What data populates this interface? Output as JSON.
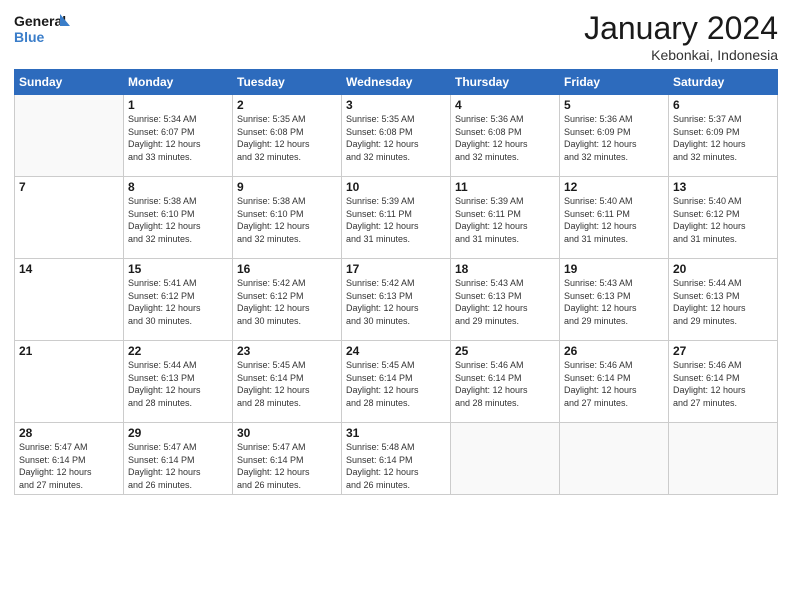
{
  "logo": {
    "line1": "General",
    "line2": "Blue"
  },
  "title": "January 2024",
  "location": "Kebonkai, Indonesia",
  "days_header": [
    "Sunday",
    "Monday",
    "Tuesday",
    "Wednesday",
    "Thursday",
    "Friday",
    "Saturday"
  ],
  "weeks": [
    [
      {
        "day": "",
        "info": ""
      },
      {
        "day": "1",
        "info": "Sunrise: 5:34 AM\nSunset: 6:07 PM\nDaylight: 12 hours\nand 33 minutes."
      },
      {
        "day": "2",
        "info": "Sunrise: 5:35 AM\nSunset: 6:08 PM\nDaylight: 12 hours\nand 32 minutes."
      },
      {
        "day": "3",
        "info": "Sunrise: 5:35 AM\nSunset: 6:08 PM\nDaylight: 12 hours\nand 32 minutes."
      },
      {
        "day": "4",
        "info": "Sunrise: 5:36 AM\nSunset: 6:08 PM\nDaylight: 12 hours\nand 32 minutes."
      },
      {
        "day": "5",
        "info": "Sunrise: 5:36 AM\nSunset: 6:09 PM\nDaylight: 12 hours\nand 32 minutes."
      },
      {
        "day": "6",
        "info": "Sunrise: 5:37 AM\nSunset: 6:09 PM\nDaylight: 12 hours\nand 32 minutes."
      }
    ],
    [
      {
        "day": "7",
        "info": ""
      },
      {
        "day": "8",
        "info": "Sunrise: 5:38 AM\nSunset: 6:10 PM\nDaylight: 12 hours\nand 32 minutes."
      },
      {
        "day": "9",
        "info": "Sunrise: 5:38 AM\nSunset: 6:10 PM\nDaylight: 12 hours\nand 32 minutes."
      },
      {
        "day": "10",
        "info": "Sunrise: 5:39 AM\nSunset: 6:11 PM\nDaylight: 12 hours\nand 31 minutes."
      },
      {
        "day": "11",
        "info": "Sunrise: 5:39 AM\nSunset: 6:11 PM\nDaylight: 12 hours\nand 31 minutes."
      },
      {
        "day": "12",
        "info": "Sunrise: 5:40 AM\nSunset: 6:11 PM\nDaylight: 12 hours\nand 31 minutes."
      },
      {
        "day": "13",
        "info": "Sunrise: 5:40 AM\nSunset: 6:12 PM\nDaylight: 12 hours\nand 31 minutes."
      }
    ],
    [
      {
        "day": "14",
        "info": ""
      },
      {
        "day": "15",
        "info": "Sunrise: 5:41 AM\nSunset: 6:12 PM\nDaylight: 12 hours\nand 30 minutes."
      },
      {
        "day": "16",
        "info": "Sunrise: 5:42 AM\nSunset: 6:12 PM\nDaylight: 12 hours\nand 30 minutes."
      },
      {
        "day": "17",
        "info": "Sunrise: 5:42 AM\nSunset: 6:13 PM\nDaylight: 12 hours\nand 30 minutes."
      },
      {
        "day": "18",
        "info": "Sunrise: 5:43 AM\nSunset: 6:13 PM\nDaylight: 12 hours\nand 29 minutes."
      },
      {
        "day": "19",
        "info": "Sunrise: 5:43 AM\nSunset: 6:13 PM\nDaylight: 12 hours\nand 29 minutes."
      },
      {
        "day": "20",
        "info": "Sunrise: 5:44 AM\nSunset: 6:13 PM\nDaylight: 12 hours\nand 29 minutes."
      }
    ],
    [
      {
        "day": "21",
        "info": ""
      },
      {
        "day": "22",
        "info": "Sunrise: 5:44 AM\nSunset: 6:13 PM\nDaylight: 12 hours\nand 28 minutes."
      },
      {
        "day": "23",
        "info": "Sunrise: 5:45 AM\nSunset: 6:14 PM\nDaylight: 12 hours\nand 28 minutes."
      },
      {
        "day": "24",
        "info": "Sunrise: 5:45 AM\nSunset: 6:14 PM\nDaylight: 12 hours\nand 28 minutes."
      },
      {
        "day": "25",
        "info": "Sunrise: 5:46 AM\nSunset: 6:14 PM\nDaylight: 12 hours\nand 28 minutes."
      },
      {
        "day": "26",
        "info": "Sunrise: 5:46 AM\nSunset: 6:14 PM\nDaylight: 12 hours\nand 27 minutes."
      },
      {
        "day": "27",
        "info": "Sunrise: 5:46 AM\nSunset: 6:14 PM\nDaylight: 12 hours\nand 27 minutes."
      }
    ],
    [
      {
        "day": "28",
        "info": "Sunrise: 5:47 AM\nSunset: 6:14 PM\nDaylight: 12 hours\nand 27 minutes."
      },
      {
        "day": "29",
        "info": "Sunrise: 5:47 AM\nSunset: 6:14 PM\nDaylight: 12 hours\nand 26 minutes."
      },
      {
        "day": "30",
        "info": "Sunrise: 5:47 AM\nSunset: 6:14 PM\nDaylight: 12 hours\nand 26 minutes."
      },
      {
        "day": "31",
        "info": "Sunrise: 5:48 AM\nSunset: 6:14 PM\nDaylight: 12 hours\nand 26 minutes."
      },
      {
        "day": "",
        "info": ""
      },
      {
        "day": "",
        "info": ""
      },
      {
        "day": "",
        "info": ""
      }
    ]
  ]
}
